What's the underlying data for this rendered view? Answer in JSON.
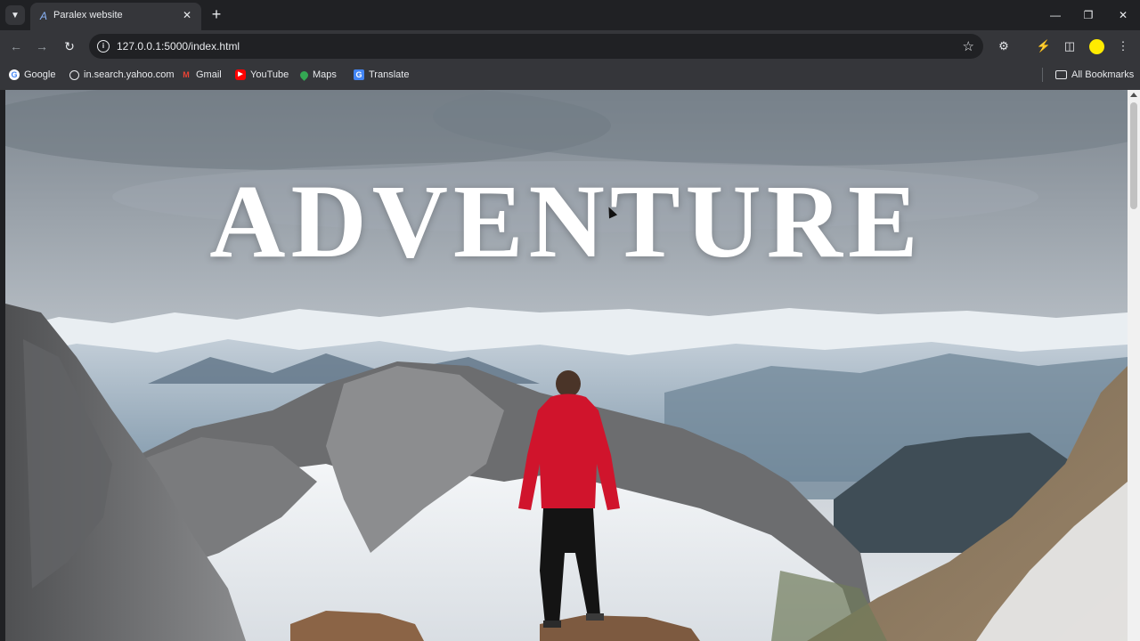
{
  "browser": {
    "tab_title": "Paralex website",
    "favicon": "A",
    "url": "127.0.0.1:5000/index.html",
    "bookmarks": [
      {
        "label": "Google",
        "icon": "G",
        "color": "#ffffff"
      },
      {
        "label": "in.search.yahoo.com",
        "icon": "globe-icon",
        "color": "#e8eaed"
      },
      {
        "label": "Gmail",
        "icon": "M",
        "color": "#ea4335"
      },
      {
        "label": "YouTube",
        "icon": "▶",
        "color": "#ff0000"
      },
      {
        "label": "Maps",
        "icon": "maps-pin-icon",
        "color": "#34a853"
      },
      {
        "label": "Translate",
        "icon": "G",
        "color": "#4285f4"
      }
    ],
    "all_bookmarks": "All Bookmarks",
    "profile_color": "#ffeb00"
  },
  "page": {
    "hero_title": "ADVENTURE"
  }
}
